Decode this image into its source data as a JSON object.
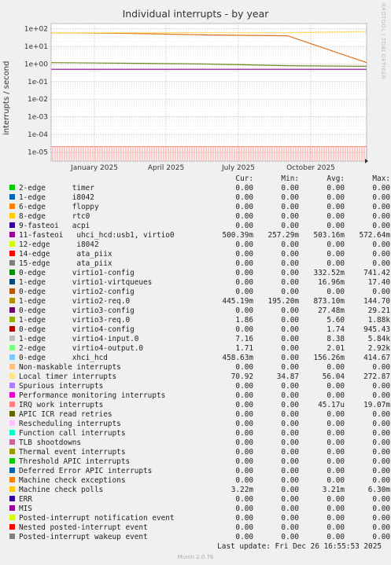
{
  "chart_data": {
    "type": "line",
    "title": "Individual interrupts - by year",
    "ylabel": "interrupts / second",
    "yscale": "log",
    "ylim": [
      3e-06,
      200
    ],
    "yticks": [
      "1e+02",
      "1e+01",
      "1e+00",
      "1e-01",
      "1e-02",
      "1e-03",
      "1e-04",
      "1e-05"
    ],
    "xticks": [
      "January 2025",
      "April 2025",
      "July 2025",
      "October 2025"
    ],
    "grid": true,
    "series_levels": [
      {
        "name": "virtio2-req.0",
        "color": "#e07020",
        "values": [
          60,
          55,
          45,
          40,
          1.2
        ]
      },
      {
        "name": "virtio1-config",
        "color": "#6b8e23",
        "values": [
          1.2,
          1.1,
          1.0,
          0.8,
          0.74
        ]
      },
      {
        "name": "uhci_hcd:usb1, virtio0",
        "color": "#8b008b",
        "values": [
          0.5,
          0.5,
          0.5,
          0.5,
          0.5
        ]
      },
      {
        "name": "Local timer interrupts",
        "color": "#ffdd66",
        "values": [
          60,
          60,
          60,
          60,
          70
        ]
      },
      {
        "name": "Non-maskable interrupts",
        "color": "#ffaa99",
        "values": [
          2e-05,
          2e-05,
          2e-05,
          2e-05,
          2e-05
        ]
      }
    ]
  },
  "legend": {
    "headers": {
      "cur": "Cur:",
      "min": "Min:",
      "avg": "Avg:",
      "max": "Max:"
    },
    "rows": [
      {
        "color": "#00cc00",
        "name": "2-edge      timer",
        "cur": "0.00",
        "min": "0.00",
        "avg": "0.00",
        "max": "0.00"
      },
      {
        "color": "#0066b3",
        "name": "1-edge      i8042",
        "cur": "0.00",
        "min": "0.00",
        "avg": "0.00",
        "max": "0.00"
      },
      {
        "color": "#ff8000",
        "name": "6-edge      floppy",
        "cur": "0.00",
        "min": "0.00",
        "avg": "0.00",
        "max": "0.00"
      },
      {
        "color": "#ffcc00",
        "name": "8-edge      rtc0",
        "cur": "0.00",
        "min": "0.00",
        "avg": "0.00",
        "max": "0.00"
      },
      {
        "color": "#330099",
        "name": "9-fasteoi   acpi",
        "cur": "0.00",
        "min": "0.00",
        "avg": "0.00",
        "max": "0.00"
      },
      {
        "color": "#990099",
        "name": "11-fasteoi   uhci_hcd:usb1, virtio0",
        "cur": "500.39m",
        "min": "257.29m",
        "avg": "503.16m",
        "max": "572.64m"
      },
      {
        "color": "#ccff00",
        "name": "12-edge      i8042",
        "cur": "0.00",
        "min": "0.00",
        "avg": "0.00",
        "max": "0.00"
      },
      {
        "color": "#ff0000",
        "name": "14-edge      ata_piix",
        "cur": "0.00",
        "min": "0.00",
        "avg": "0.00",
        "max": "0.00"
      },
      {
        "color": "#808080",
        "name": "15-edge      ata_piix",
        "cur": "0.00",
        "min": "0.00",
        "avg": "0.00",
        "max": "0.00"
      },
      {
        "color": "#008f00",
        "name": "0-edge      virtio1-config",
        "cur": "0.00",
        "min": "0.00",
        "avg": "332.52m",
        "max": "741.42"
      },
      {
        "color": "#00487d",
        "name": "1-edge      virtio1-virtqueues",
        "cur": "0.00",
        "min": "0.00",
        "avg": "16.96m",
        "max": "17.40"
      },
      {
        "color": "#b35a00",
        "name": "0-edge      virtio2-config",
        "cur": "0.00",
        "min": "0.00",
        "avg": "0.00",
        "max": "0.00"
      },
      {
        "color": "#b38f00",
        "name": "1-edge      virtio2-req.0",
        "cur": "445.19m",
        "min": "195.20m",
        "avg": "873.10m",
        "max": "144.70"
      },
      {
        "color": "#6b006b",
        "name": "0-edge      virtio3-config",
        "cur": "0.00",
        "min": "0.00",
        "avg": "27.48m",
        "max": "29.21"
      },
      {
        "color": "#8fb300",
        "name": "1-edge      virtio3-req.0",
        "cur": "1.86",
        "min": "0.00",
        "avg": "5.60",
        "max": "1.88k"
      },
      {
        "color": "#b30000",
        "name": "0-edge      virtio4-config",
        "cur": "0.00",
        "min": "0.00",
        "avg": "1.74",
        "max": "945.43"
      },
      {
        "color": "#bebebe",
        "name": "1-edge      virtio4-input.0",
        "cur": "7.16",
        "min": "0.00",
        "avg": "8.38",
        "max": "5.84k"
      },
      {
        "color": "#80ff80",
        "name": "2-edge      virtio4-output.0",
        "cur": "1.71",
        "min": "0.00",
        "avg": "2.01",
        "max": "2.92k"
      },
      {
        "color": "#80c9ff",
        "name": "0-edge      xhci_hcd",
        "cur": "458.63m",
        "min": "0.00",
        "avg": "156.26m",
        "max": "414.67"
      },
      {
        "color": "#ffc080",
        "name": "Non-maskable interrupts",
        "cur": "0.00",
        "min": "0.00",
        "avg": "0.00",
        "max": "0.00"
      },
      {
        "color": "#ffe680",
        "name": "Local timer interrupts",
        "cur": "70.92",
        "min": "34.87",
        "avg": "56.04",
        "max": "272.87"
      },
      {
        "color": "#aa80ff",
        "name": "Spurious interrupts",
        "cur": "0.00",
        "min": "0.00",
        "avg": "0.00",
        "max": "0.00"
      },
      {
        "color": "#ee00cc",
        "name": "Performance monitoring interrupts",
        "cur": "0.00",
        "min": "0.00",
        "avg": "0.00",
        "max": "0.00"
      },
      {
        "color": "#ff8080",
        "name": "IRQ work interrupts",
        "cur": "0.00",
        "min": "0.00",
        "avg": "45.17u",
        "max": "19.07m"
      },
      {
        "color": "#666600",
        "name": "APIC ICR read retries",
        "cur": "0.00",
        "min": "0.00",
        "avg": "0.00",
        "max": "0.00"
      },
      {
        "color": "#ffbfff",
        "name": "Rescheduling interrupts",
        "cur": "0.00",
        "min": "0.00",
        "avg": "0.00",
        "max": "0.00"
      },
      {
        "color": "#00ffcc",
        "name": "Function call interrupts",
        "cur": "0.00",
        "min": "0.00",
        "avg": "0.00",
        "max": "0.00"
      },
      {
        "color": "#cc6699",
        "name": "TLB shootdowns",
        "cur": "0.00",
        "min": "0.00",
        "avg": "0.00",
        "max": "0.00"
      },
      {
        "color": "#999900",
        "name": "Thermal event interrupts",
        "cur": "0.00",
        "min": "0.00",
        "avg": "0.00",
        "max": "0.00"
      },
      {
        "color": "#00cc00",
        "name": "Threshold APIC interrupts",
        "cur": "0.00",
        "min": "0.00",
        "avg": "0.00",
        "max": "0.00"
      },
      {
        "color": "#0066b3",
        "name": "Deferred Error APIC interrupts",
        "cur": "0.00",
        "min": "0.00",
        "avg": "0.00",
        "max": "0.00"
      },
      {
        "color": "#ff8000",
        "name": "Machine check exceptions",
        "cur": "0.00",
        "min": "0.00",
        "avg": "0.00",
        "max": "0.00"
      },
      {
        "color": "#ffcc00",
        "name": "Machine check polls",
        "cur": "3.22m",
        "min": "0.00",
        "avg": "3.21m",
        "max": "6.30m"
      },
      {
        "color": "#330099",
        "name": "ERR",
        "cur": "0.00",
        "min": "0.00",
        "avg": "0.00",
        "max": "0.00"
      },
      {
        "color": "#990099",
        "name": "MIS",
        "cur": "0.00",
        "min": "0.00",
        "avg": "0.00",
        "max": "0.00"
      },
      {
        "color": "#ccff00",
        "name": "Posted-interrupt notification event",
        "cur": "0.00",
        "min": "0.00",
        "avg": "0.00",
        "max": "0.00"
      },
      {
        "color": "#ff0000",
        "name": "Nested posted-interrupt event",
        "cur": "0.00",
        "min": "0.00",
        "avg": "0.00",
        "max": "0.00"
      },
      {
        "color": "#808080",
        "name": "Posted-interrupt wakeup event",
        "cur": "0.00",
        "min": "0.00",
        "avg": "0.00",
        "max": "0.00"
      }
    ]
  },
  "footer": "Last update: Fri Dec 26 16:55:53 2025",
  "side_text": "RRDTOOL / TOBI OETIKER",
  "version": "Munin 2.0.76"
}
